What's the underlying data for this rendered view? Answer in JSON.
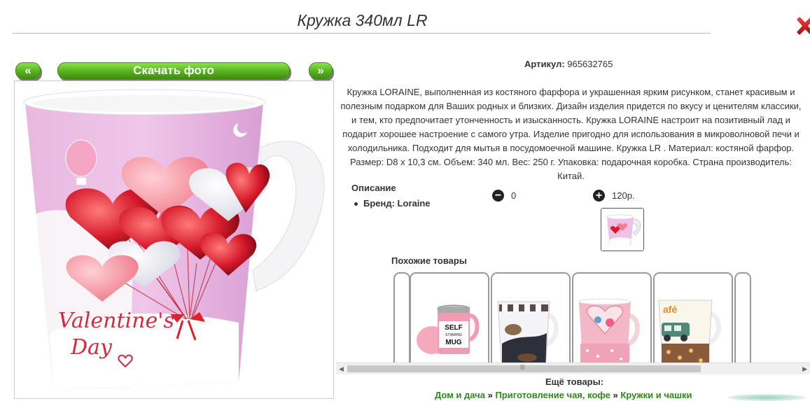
{
  "page": {
    "title": "Кружка 340мл LR"
  },
  "nav": {
    "prev_label": "«",
    "download_label": "Скачать фото",
    "next_label": "»"
  },
  "photo": {
    "mug_text_line1": "Valentine's",
    "mug_text_line2": "Day"
  },
  "product": {
    "article_label": "Артикул:",
    "article_value": "965632765",
    "description": "Кружка LORAINE, выполненная из костяного фарфора и украшенная ярким рисунком, станет красивым и полезным подарком для Ваших родных и близких. Дизайн изделия придется по вкусу и ценителям классики, и тем, кто предпочитает утонченность и изысканность. Кружка LORAINE настроит на позитивный лад и подарит хорошее настроение с самого утра. Изделие пригодно для использования в микроволновой печи и холодильника. Подходит для мытья в посудомоечной машине. Кружка LR . Материал: костяной фарфор. Размер: D8 x 10,3 см. Объем: 340 мл. Вес: 250 г. Упаковка: подарочная коробка. Страна производитель: Китай.",
    "spec_heading": "Описание",
    "brand_label": "Бренд: Loraine"
  },
  "votes": {
    "minus_icon": "−",
    "minus_count": "0",
    "plus_icon": "+",
    "plus_value": "120р."
  },
  "similar": {
    "heading": "Похожие товары",
    "item1_text_line1": "SELF",
    "item1_text_line2": "STIRRING",
    "item1_text_line3": "MUG"
  },
  "more": {
    "heading": "Ещё товары:",
    "crumbs": [
      "Дом и дача",
      "Приготовление чая, кофе",
      "Кружки и чашки"
    ],
    "separator": " » "
  },
  "colors": {
    "accent_green": "#57b21c",
    "link_green": "#2e8b1a",
    "close_red": "#d32020"
  }
}
